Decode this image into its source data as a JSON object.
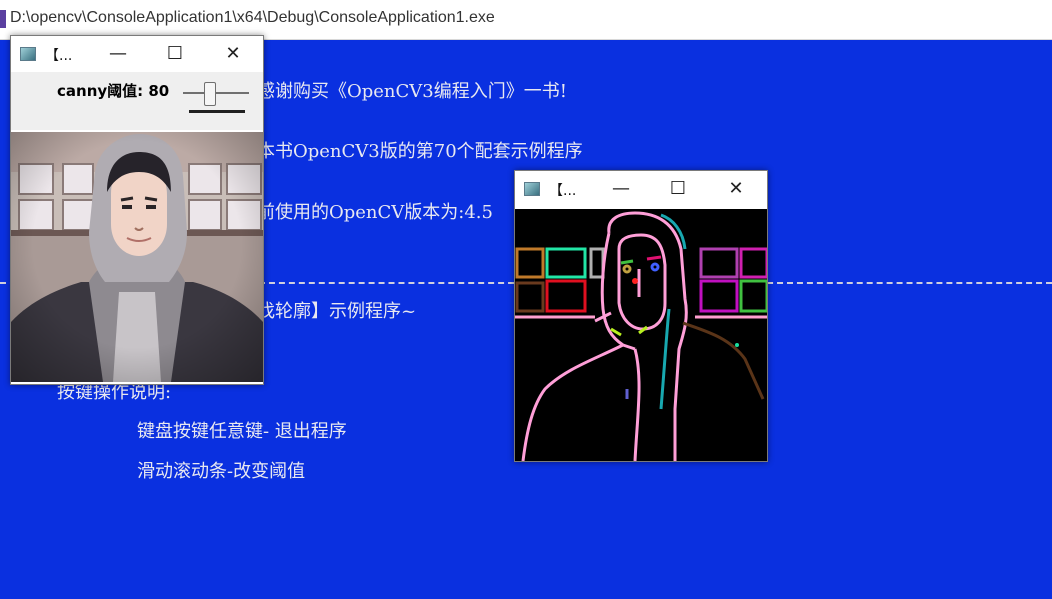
{
  "console": {
    "title": "D:\\opencv\\ConsoleApplication1\\x64\\Debug\\ConsoleApplication1.exe",
    "lines": {
      "thanks": "感谢购买《OpenCV3编程入门》一书!",
      "program": "本书OpenCV3版的第70个配套示例程序",
      "version": "前使用的OpenCV版本为:4.5",
      "demo": "找轮廓】示例程序~",
      "keys_title": "按键操作说明:",
      "key_exit": "键盘按键任意键- 退出程序",
      "key_slider": "滑动滚动条-改变阈值"
    }
  },
  "window_source": {
    "title": "【...",
    "min_label": "—",
    "max_label": "☐",
    "close_label": "✕",
    "trackbar_label": "canny阈值: 80",
    "trackbar_value": 80
  },
  "window_contours": {
    "title": "【...",
    "min_label": "—",
    "max_label": "☐",
    "close_label": "✕"
  }
}
